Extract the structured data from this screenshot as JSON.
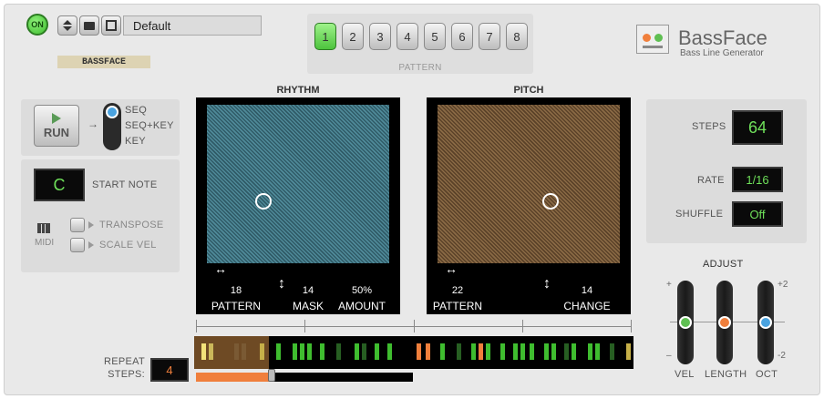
{
  "power": {
    "label": "ON"
  },
  "preset": {
    "name": "Default"
  },
  "brand_tag": "BASSFACE",
  "patterns": {
    "items": [
      "1",
      "2",
      "3",
      "4",
      "5",
      "6",
      "7",
      "8"
    ],
    "active": "1",
    "label": "PATTERN"
  },
  "app": {
    "title": "BassFace",
    "subtitle": "Bass Line Generator"
  },
  "run": {
    "label": "RUN"
  },
  "mode": {
    "options": [
      "SEQ",
      "SEQ+KEY",
      "KEY"
    ],
    "selected": "SEQ"
  },
  "start_note": {
    "value": "C",
    "label": "START NOTE"
  },
  "midi": {
    "label": "MIDI",
    "transpose_label": "TRANSPOSE",
    "scale_vel_label": "SCALE VEL"
  },
  "rhythm": {
    "title": "RHYTHM",
    "pattern_value": "18",
    "pattern_label": "PATTERN",
    "mask_value": "14",
    "mask_label": "MASK",
    "amount_value": "50%",
    "amount_label": "AMOUNT"
  },
  "pitch": {
    "title": "PITCH",
    "pattern_value": "22",
    "pattern_label": "PATTERN",
    "change_value": "14",
    "change_label": "CHANGE"
  },
  "settings": {
    "steps_label": "STEPS",
    "steps_value": "64",
    "rate_label": "RATE",
    "rate_value": "1/16",
    "shuffle_label": "SHUFFLE",
    "shuffle_value": "Off"
  },
  "adjust": {
    "title": "ADJUST",
    "plus": "+",
    "minus": "–",
    "plus2": "+2",
    "minus2": "-2",
    "vel_label": "VEL",
    "length_label": "LENGTH",
    "oct_label": "OCT"
  },
  "repeat": {
    "label_line1": "REPEAT",
    "label_line2": "STEPS:",
    "value": "4",
    "level_fraction": 0.35
  },
  "colors": {
    "lcd_green": "#6fe05a",
    "orange": "#f07f3c",
    "rhythm_pad": "#4f8a99",
    "pitch_pad": "#8a6a45",
    "fader_green": "#5fbf52",
    "fader_orange": "#f07f3c",
    "fader_blue": "#4aa3e0"
  }
}
